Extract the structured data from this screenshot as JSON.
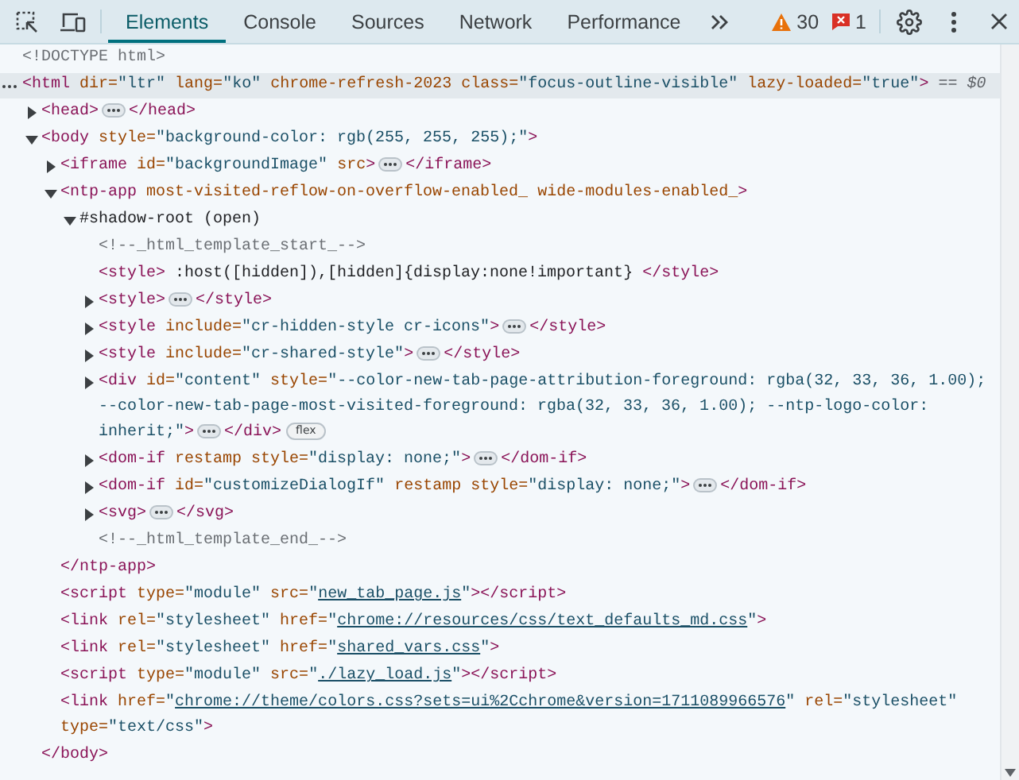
{
  "toolbar": {
    "tabs": [
      {
        "label": "Elements",
        "selected": true
      },
      {
        "label": "Console",
        "selected": false
      },
      {
        "label": "Sources",
        "selected": false
      },
      {
        "label": "Network",
        "selected": false
      },
      {
        "label": "Performance",
        "selected": false
      }
    ],
    "warnings": "30",
    "errors": "1"
  },
  "dom": {
    "nodes": [
      {
        "selected": false,
        "parts": [
          {
            "kind": "comment",
            "text": "<!DOCTYPE html>"
          }
        ]
      },
      {
        "selected": true,
        "reference": "== $0",
        "parts": [
          {
            "kind": "tag",
            "text": "<html"
          },
          {
            "kind": "attr",
            "text": " dir="
          },
          {
            "kind": "value",
            "text": "\"ltr\""
          },
          {
            "kind": "attr",
            "text": " lang="
          },
          {
            "kind": "value",
            "text": "\"ko\""
          },
          {
            "kind": "attr",
            "text": " chrome-refresh-2023"
          },
          {
            "kind": "attr",
            "text": " class="
          },
          {
            "kind": "value",
            "text": "\"focus-outline-visible\""
          },
          {
            "kind": "attr",
            "text": " lazy-loaded="
          },
          {
            "kind": "value",
            "text": "\"true\""
          },
          {
            "kind": "tag",
            "text": ">"
          }
        ],
        "children": [
          {
            "selected": false,
            "expanded": false,
            "parts": [
              {
                "kind": "tag",
                "text": "<head>"
              }
            ],
            "after": [
              {
                "kind": "tag",
                "text": "</head>"
              }
            ]
          },
          {
            "selected": false,
            "expanded": true,
            "parts": [
              {
                "kind": "tag",
                "text": "<body"
              },
              {
                "kind": "attr",
                "text": " style="
              },
              {
                "kind": "value",
                "text": "\"background-color: rgb(255, 255, 255);\""
              },
              {
                "kind": "tag",
                "text": ">"
              }
            ],
            "children": [
              {
                "selected": false,
                "expanded": false,
                "parts": [
                  {
                    "kind": "tag",
                    "text": "<iframe"
                  },
                  {
                    "kind": "attr",
                    "text": " id="
                  },
                  {
                    "kind": "value",
                    "text": "\"backgroundImage\""
                  },
                  {
                    "kind": "attr",
                    "text": " src"
                  },
                  {
                    "kind": "tag",
                    "text": ">"
                  }
                ],
                "after": [
                  {
                    "kind": "tag",
                    "text": "</iframe>"
                  }
                ]
              },
              {
                "selected": false,
                "expanded": true,
                "parts": [
                  {
                    "kind": "tag",
                    "text": "<ntp-app"
                  },
                  {
                    "kind": "attr",
                    "text": " most-visited-reflow-on-overflow-enabled_"
                  },
                  {
                    "kind": "attr",
                    "text": " wide-modules-enabled_"
                  },
                  {
                    "kind": "tag",
                    "text": ">"
                  }
                ],
                "children": [
                  {
                    "selected": false,
                    "expanded": true,
                    "parts": [
                      {
                        "kind": "text",
                        "text": "#shadow-root (open)"
                      }
                    ],
                    "children": [
                      {
                        "selected": false,
                        "parts": [
                          {
                            "kind": "comment",
                            "text": "<!--_html_template_start_-->"
                          }
                        ]
                      },
                      {
                        "selected": false,
                        "parts": [
                          {
                            "kind": "tag",
                            "text": "<style>"
                          },
                          {
                            "kind": "text",
                            "text": " :host([hidden]),[hidden]{display:none!important} "
                          },
                          {
                            "kind": "tag",
                            "text": "</style>"
                          }
                        ]
                      },
                      {
                        "selected": false,
                        "expanded": false,
                        "parts": [
                          {
                            "kind": "tag",
                            "text": "<style>"
                          }
                        ],
                        "after": [
                          {
                            "kind": "tag",
                            "text": "</style>"
                          }
                        ]
                      },
                      {
                        "selected": false,
                        "expanded": false,
                        "parts": [
                          {
                            "kind": "tag",
                            "text": "<style"
                          },
                          {
                            "kind": "attr",
                            "text": " include="
                          },
                          {
                            "kind": "value",
                            "text": "\"cr-hidden-style cr-icons\""
                          },
                          {
                            "kind": "tag",
                            "text": ">"
                          }
                        ],
                        "after": [
                          {
                            "kind": "tag",
                            "text": "</style>"
                          }
                        ]
                      },
                      {
                        "selected": false,
                        "expanded": false,
                        "parts": [
                          {
                            "kind": "tag",
                            "text": "<style"
                          },
                          {
                            "kind": "attr",
                            "text": " include="
                          },
                          {
                            "kind": "value",
                            "text": "\"cr-shared-style\""
                          },
                          {
                            "kind": "tag",
                            "text": ">"
                          }
                        ],
                        "after": [
                          {
                            "kind": "tag",
                            "text": "</style>"
                          }
                        ]
                      },
                      {
                        "selected": false,
                        "expanded": false,
                        "badge": "flex",
                        "parts": [
                          {
                            "kind": "tag",
                            "text": "<div"
                          },
                          {
                            "kind": "attr",
                            "text": " id="
                          },
                          {
                            "kind": "value",
                            "text": "\"content\""
                          },
                          {
                            "kind": "attr",
                            "text": " style="
                          },
                          {
                            "kind": "value",
                            "text": "\"--color-new-tab-page-attribution-foreground: rgba(32, 33, 36, 1.00); --color-new-tab-page-most-visited-foreground: rgba(32, 33, 36, 1.00); --ntp-logo-color: inherit;\""
                          },
                          {
                            "kind": "tag",
                            "text": ">"
                          }
                        ],
                        "after": [
                          {
                            "kind": "tag",
                            "text": "</div>"
                          }
                        ]
                      },
                      {
                        "selected": false,
                        "expanded": false,
                        "parts": [
                          {
                            "kind": "tag",
                            "text": "<dom-if"
                          },
                          {
                            "kind": "attr",
                            "text": " restamp"
                          },
                          {
                            "kind": "attr",
                            "text": " style="
                          },
                          {
                            "kind": "value",
                            "text": "\"display: none;\""
                          },
                          {
                            "kind": "tag",
                            "text": ">"
                          }
                        ],
                        "after": [
                          {
                            "kind": "tag",
                            "text": "</dom-if>"
                          }
                        ]
                      },
                      {
                        "selected": false,
                        "expanded": false,
                        "parts": [
                          {
                            "kind": "tag",
                            "text": "<dom-if"
                          },
                          {
                            "kind": "attr",
                            "text": " id="
                          },
                          {
                            "kind": "value",
                            "text": "\"customizeDialogIf\""
                          },
                          {
                            "kind": "attr",
                            "text": " restamp"
                          },
                          {
                            "kind": "attr",
                            "text": " style="
                          },
                          {
                            "kind": "value",
                            "text": "\"display: none;\""
                          },
                          {
                            "kind": "tag",
                            "text": ">"
                          }
                        ],
                        "after": [
                          {
                            "kind": "tag",
                            "text": "</dom-if>"
                          }
                        ]
                      },
                      {
                        "selected": false,
                        "expanded": false,
                        "parts": [
                          {
                            "kind": "tag",
                            "text": "<svg>"
                          }
                        ],
                        "after": [
                          {
                            "kind": "tag",
                            "text": "</svg>"
                          }
                        ]
                      },
                      {
                        "selected": false,
                        "parts": [
                          {
                            "kind": "comment",
                            "text": "<!--_html_template_end_-->"
                          }
                        ]
                      }
                    ]
                  }
                ],
                "closing": [
                  {
                    "kind": "tag",
                    "text": "</ntp-app>"
                  }
                ]
              },
              {
                "selected": false,
                "parts": [
                  {
                    "kind": "tag",
                    "text": "<script"
                  },
                  {
                    "kind": "attr",
                    "text": " type="
                  },
                  {
                    "kind": "value",
                    "text": "\"module\""
                  },
                  {
                    "kind": "attr",
                    "text": " src="
                  },
                  {
                    "kind": "value",
                    "text": "\""
                  },
                  {
                    "kind": "link",
                    "text": "new_tab_page.js"
                  },
                  {
                    "kind": "value",
                    "text": "\""
                  },
                  {
                    "kind": "tag",
                    "text": "></script>"
                  }
                ]
              },
              {
                "selected": false,
                "parts": [
                  {
                    "kind": "tag",
                    "text": "<link"
                  },
                  {
                    "kind": "attr",
                    "text": " rel="
                  },
                  {
                    "kind": "value",
                    "text": "\"stylesheet\""
                  },
                  {
                    "kind": "attr",
                    "text": " href="
                  },
                  {
                    "kind": "value",
                    "text": "\""
                  },
                  {
                    "kind": "link",
                    "text": "chrome://resources/css/text_defaults_md.css"
                  },
                  {
                    "kind": "value",
                    "text": "\""
                  },
                  {
                    "kind": "tag",
                    "text": ">"
                  }
                ]
              },
              {
                "selected": false,
                "parts": [
                  {
                    "kind": "tag",
                    "text": "<link"
                  },
                  {
                    "kind": "attr",
                    "text": " rel="
                  },
                  {
                    "kind": "value",
                    "text": "\"stylesheet\""
                  },
                  {
                    "kind": "attr",
                    "text": " href="
                  },
                  {
                    "kind": "value",
                    "text": "\""
                  },
                  {
                    "kind": "link",
                    "text": "shared_vars.css"
                  },
                  {
                    "kind": "value",
                    "text": "\""
                  },
                  {
                    "kind": "tag",
                    "text": ">"
                  }
                ]
              },
              {
                "selected": false,
                "parts": [
                  {
                    "kind": "tag",
                    "text": "<script"
                  },
                  {
                    "kind": "attr",
                    "text": " type="
                  },
                  {
                    "kind": "value",
                    "text": "\"module\""
                  },
                  {
                    "kind": "attr",
                    "text": " src="
                  },
                  {
                    "kind": "value",
                    "text": "\""
                  },
                  {
                    "kind": "link",
                    "text": "./lazy_load.js"
                  },
                  {
                    "kind": "value",
                    "text": "\""
                  },
                  {
                    "kind": "tag",
                    "text": "></script>"
                  }
                ]
              },
              {
                "selected": false,
                "parts": [
                  {
                    "kind": "tag",
                    "text": "<link"
                  },
                  {
                    "kind": "attr",
                    "text": " href="
                  },
                  {
                    "kind": "value",
                    "text": "\""
                  },
                  {
                    "kind": "link",
                    "text": "chrome://theme/colors.css?sets=ui%2Cchrome&version=1711089966576"
                  },
                  {
                    "kind": "value",
                    "text": "\""
                  },
                  {
                    "kind": "attr",
                    "text": " rel="
                  },
                  {
                    "kind": "value",
                    "text": "\"stylesheet\""
                  },
                  {
                    "kind": "attr",
                    "text": " type="
                  },
                  {
                    "kind": "value",
                    "text": "\"text/css\""
                  },
                  {
                    "kind": "tag",
                    "text": ">"
                  }
                ]
              }
            ],
            "closing": [
              {
                "kind": "tag",
                "text": "</body>"
              }
            ]
          }
        ]
      }
    ]
  }
}
